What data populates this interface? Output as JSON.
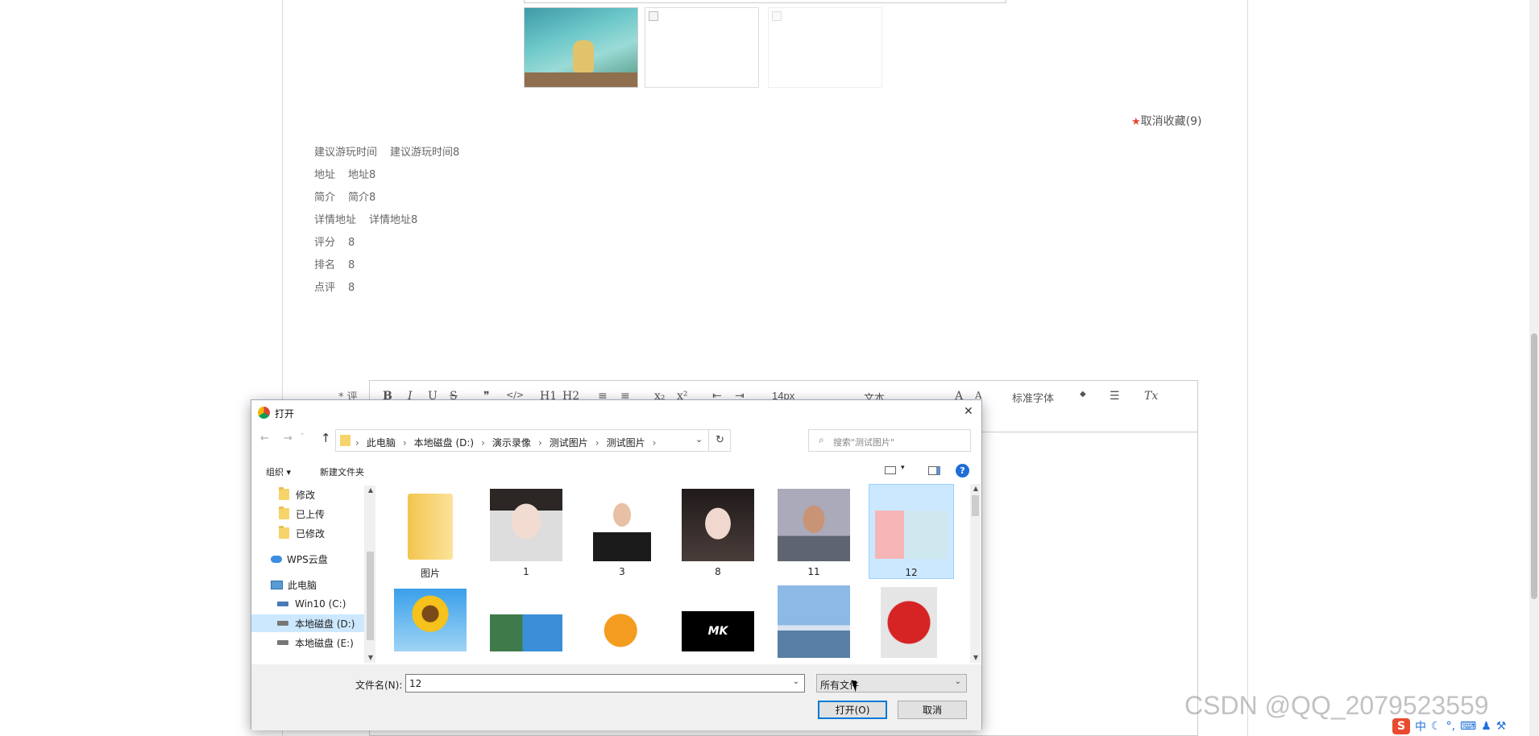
{
  "card": {
    "favorite_label": "取消收藏(9)",
    "star": "★",
    "colors": {
      "star": "#e8452f",
      "border": "#d9d9d9"
    }
  },
  "details": [
    {
      "key": "建议游玩时间",
      "value": "建议游玩时间8"
    },
    {
      "key": "地址",
      "value": "地址8"
    },
    {
      "key": "简介",
      "value": "简介8"
    },
    {
      "key": "详情地址",
      "value": "详情地址8"
    },
    {
      "key": "评分",
      "value": "8"
    },
    {
      "key": "排名",
      "value": "8"
    },
    {
      "key": "点评",
      "value": "8"
    }
  ],
  "comment": {
    "label": "* 评"
  },
  "editor": {
    "tools": [
      "B",
      "I",
      "U",
      "S",
      "❞",
      "</>",
      "H1",
      "H2",
      "≡",
      "≡",
      "x₂",
      "x²",
      "⇤",
      "⇥"
    ],
    "font_size": "14px",
    "block_type": "文本",
    "font_family": "标准字体",
    "align_icon": "align-icon",
    "clear_format": "Tx"
  },
  "dialog": {
    "title": "打开",
    "close": "✕",
    "breadcrumb": [
      "此电脑",
      "本地磁盘 (D:)",
      "演示录像",
      "测试图片",
      "测试图片"
    ],
    "search_placeholder": "搜索\"测试图片\"",
    "organize": "组织 ▾",
    "new_folder": "新建文件夹",
    "help": "?",
    "nav": [
      {
        "label": "修改",
        "type": "folder"
      },
      {
        "label": "已上传",
        "type": "folder"
      },
      {
        "label": "已修改",
        "type": "folder"
      },
      {
        "label": "WPS云盘",
        "type": "cloud"
      },
      {
        "label": "此电脑",
        "type": "pc"
      },
      {
        "label": "Win10 (C:)",
        "type": "drive"
      },
      {
        "label": "本地磁盘 (D:)",
        "type": "drive",
        "selected": true
      },
      {
        "label": "本地磁盘 (E:)",
        "type": "drive"
      }
    ],
    "files_row1": [
      {
        "label": "图片",
        "kind": "folder"
      },
      {
        "label": "1",
        "kind": "portrait-girl"
      },
      {
        "label": "3",
        "kind": "portrait-man"
      },
      {
        "label": "8",
        "kind": "portrait-woman"
      },
      {
        "label": "11",
        "kind": "portrait-man2"
      },
      {
        "label": "12",
        "kind": "scene",
        "selected": true
      }
    ],
    "files_row2": [
      {
        "kind": "sunflower"
      },
      {
        "kind": "building"
      },
      {
        "kind": "orange"
      },
      {
        "kind": "logo"
      },
      {
        "kind": "sea"
      },
      {
        "kind": "strawberry"
      }
    ],
    "filename_label": "文件名(N):",
    "filename_value": "12",
    "filetype_value": "所有文件",
    "open_button": "打开(O)",
    "cancel_button": "取消",
    "colors": {
      "selection": "#cce8ff",
      "primary_border": "#0078d7"
    }
  },
  "watermark": "CSDN @QQ_2079523559",
  "tray": "中"
}
